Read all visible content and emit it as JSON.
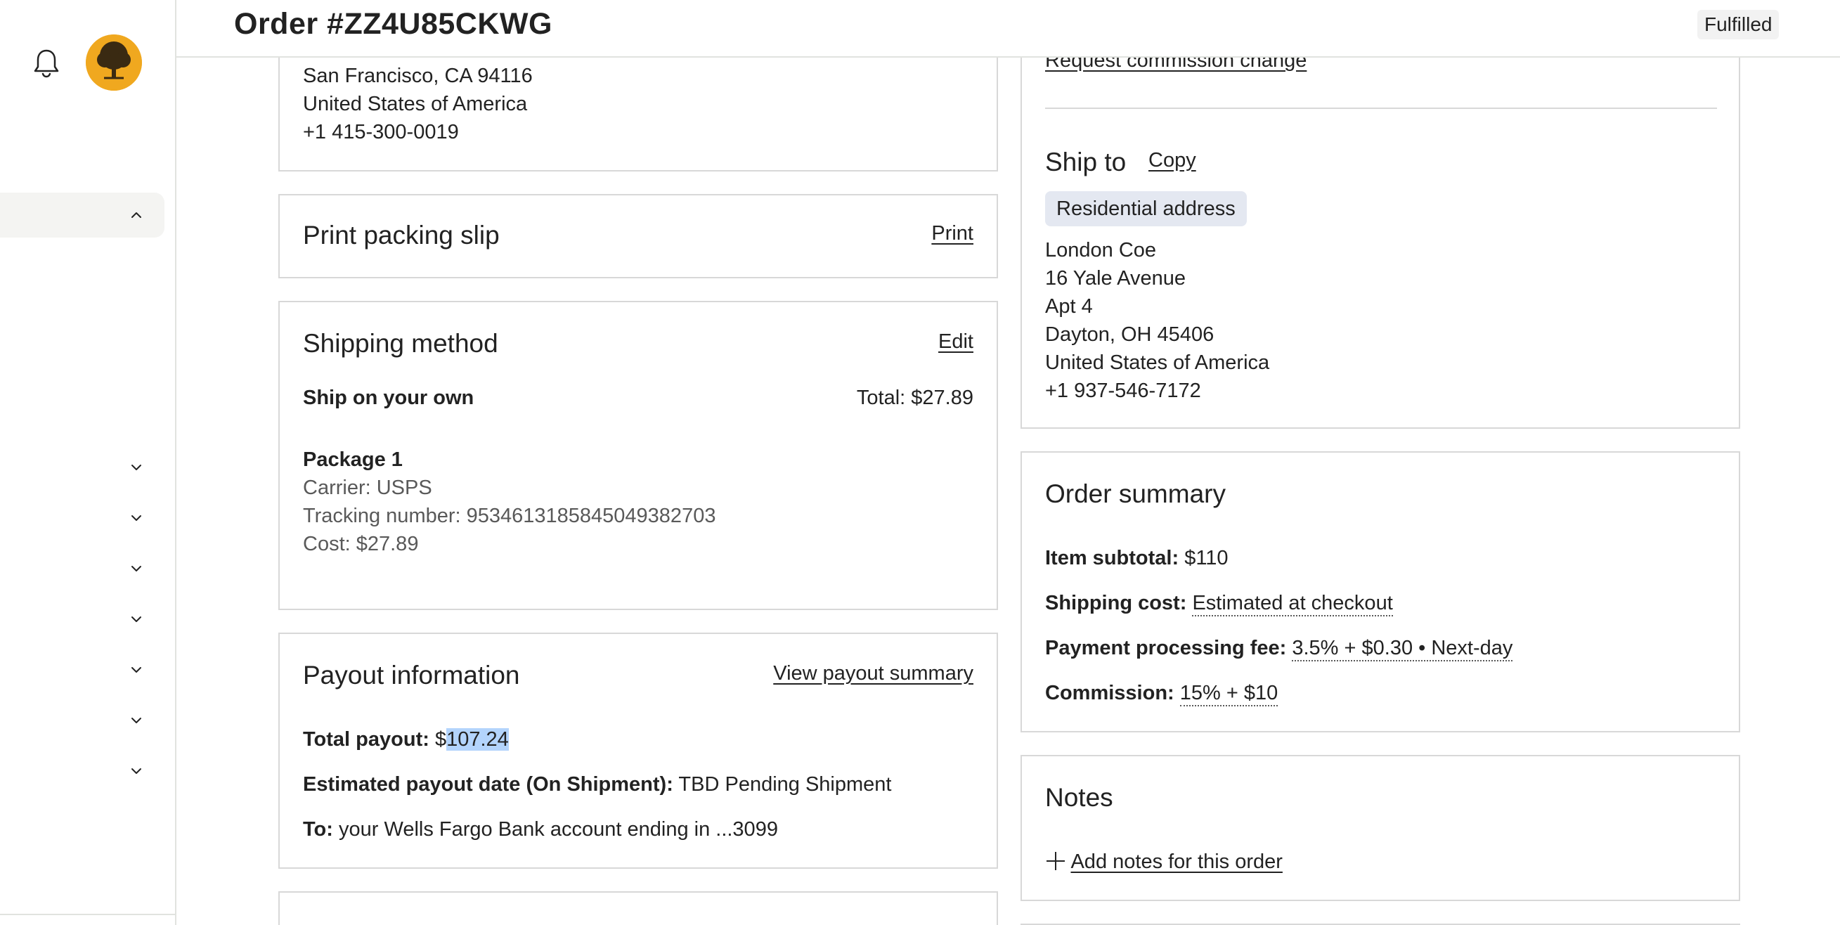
{
  "header": {
    "order_title": "Order #ZZ4U85CKWG",
    "status": "Fulfilled"
  },
  "buyer_address": {
    "lines": [
      "San Francisco, CA 94116",
      "United States of America",
      "+1 415-300-0019"
    ]
  },
  "packing_slip": {
    "title": "Print packing slip",
    "action": "Print"
  },
  "shipping_method": {
    "title": "Shipping method",
    "action": "Edit",
    "method": "Ship on your own",
    "total": "Total: $27.89",
    "package_title": "Package 1",
    "carrier": "Carrier: USPS",
    "tracking": "Tracking number: 9534613185845049382703",
    "cost": "Cost: $27.89"
  },
  "payout": {
    "title": "Payout information",
    "action": "View payout summary",
    "total_label": "Total payout:",
    "total_currency": "$",
    "total_value": "107.24",
    "date_label": "Estimated payout date (On Shipment):",
    "date_value": "TBD Pending Shipment",
    "to_label": "To:",
    "to_value": "your Wells Fargo Bank account ending in ...3099"
  },
  "commission": {
    "action": "Request commission change"
  },
  "ship_to": {
    "title": "Ship to",
    "copy": "Copy",
    "badge": "Residential address",
    "lines": [
      "London Coe",
      "16 Yale Avenue",
      "Apt 4",
      "Dayton, OH 45406",
      "United States of America",
      "+1 937-546-7172"
    ]
  },
  "order_summary": {
    "title": "Order summary",
    "subtotal_label": "Item subtotal:",
    "subtotal_value": "$110",
    "shipping_label": "Shipping cost:",
    "shipping_value": "Estimated at checkout",
    "fee_label": "Payment processing fee:",
    "fee_value": "3.5% + $0.30 • Next-day",
    "commission_label": "Commission:",
    "commission_value": "15% + $10"
  },
  "notes": {
    "title": "Notes",
    "add_label": "Add notes for this order"
  },
  "colors": {
    "border": "#d8d8d8",
    "text": "#222222",
    "muted": "#595959",
    "badge_bg": "#e4e8f1",
    "selection": "#b3d4fc",
    "avatar_bg": "#f0a81f"
  },
  "icons": [
    "bell-icon",
    "avatar-logo",
    "chevron-up-icon",
    "chevron-down-icon",
    "plus-icon"
  ]
}
